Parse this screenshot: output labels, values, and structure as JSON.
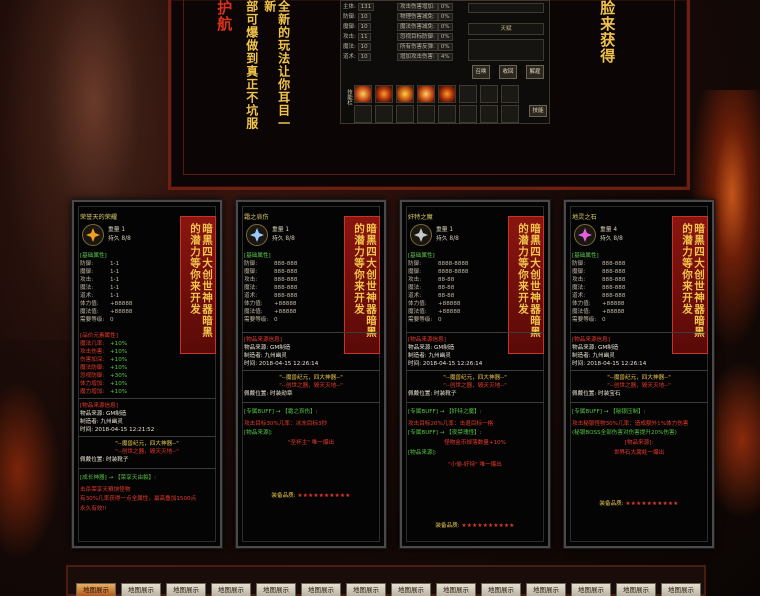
{
  "banner": {
    "col_a": "护航",
    "col_b": "部可爆做到真正不坑服",
    "col_c": "全新的玩法让你耳目一新",
    "col_d": "脸来获得"
  },
  "game_window": {
    "stats_left": [
      {
        "label": "主体:",
        "value": "131"
      },
      {
        "label": "防御:",
        "value": "10"
      },
      {
        "label": "魔御:",
        "value": "10"
      },
      {
        "label": "攻击:",
        "value": "11"
      },
      {
        "label": "魔法:",
        "value": "10"
      },
      {
        "label": "道术:",
        "value": "10"
      }
    ],
    "stats_right": [
      {
        "label": "攻击伤害增加:",
        "value": "0%"
      },
      {
        "label": "物理伤害减免:",
        "value": "0%"
      },
      {
        "label": "魔法伤害减免:",
        "value": "0%"
      },
      {
        "label": "忽视目标防御:",
        "value": "0%"
      },
      {
        "label": "所有伤害反弹:",
        "value": "0%"
      },
      {
        "label": "增加攻击伤害:",
        "value": "4%"
      }
    ],
    "field_label": "天赋",
    "buttons": [
      "召唤",
      "收回",
      "解雇"
    ],
    "skill_label": "技能栏",
    "skill_button": "技能"
  },
  "cards": [
    {
      "title": "荣誉天的荣耀",
      "meta": [
        "重量 1",
        "持久 8/8"
      ],
      "tag": "暗黑四大创世神器暗黑的潜力等你来开发",
      "base_head": "[基础属性]",
      "base": [
        [
          "防御:",
          "1-1"
        ],
        [
          "魔御:",
          "1-1"
        ],
        [
          "攻击:",
          "1-1"
        ],
        [
          "魔法:",
          "1-1"
        ],
        [
          "道术:",
          "1-1"
        ],
        [
          "体力值:",
          "+88888"
        ],
        [
          "魔法值:",
          "+88888"
        ],
        [
          "需要等级:",
          "0"
        ]
      ],
      "extra_head": "[品价元素属性]",
      "extra": [
        [
          "魔法几率:",
          "+10%"
        ],
        [
          "攻击伤害:",
          "+10%"
        ],
        [
          "伤害加深:",
          "+10%"
        ],
        [
          "魔法防御:",
          "+10%"
        ],
        [
          "忽视防御:",
          "+30%"
        ],
        [
          "体力增加:",
          "+10%"
        ],
        [
          "魔力增加:",
          "+10%"
        ]
      ],
      "src_head": "[物品来源信息]",
      "src": [
        "物品来源:   GM制造",
        "制造者:      九州幽灵",
        "时间:         2018-04-15 12:21:52"
      ],
      "legend1": "\"--魔兽纪元，四大神器--\"",
      "legend2": "\"--创世之器，毁天灭地--\"",
      "pos": "佩戴位置:       时装靴子",
      "link_head": "[成长神器] → 【荣享天由裂】:",
      "desc": "击杀荣享天粮饷怪物",
      "desc2": "有30%几率获得一点全属性，最高叠加1500点",
      "desc3": "永久有效!!",
      "stars_label": "",
      "stars": ""
    },
    {
      "title": "霜之哀伤",
      "meta": [
        "重量 1",
        "持久 8/8"
      ],
      "tag": "暗黑四大创世神器暗黑的潜力等你来开发",
      "base_head": "[基础属性]",
      "base": [
        [
          "防御:",
          "888-888"
        ],
        [
          "魔御:",
          "888-888"
        ],
        [
          "攻击:",
          "888-888"
        ],
        [
          "魔法:",
          "888-888"
        ],
        [
          "道术:",
          "888-888"
        ],
        [
          "体力值:",
          "+88888"
        ],
        [
          "魔法值:",
          "+88888"
        ],
        [
          "需要等级:",
          "0"
        ]
      ],
      "extra_head": "",
      "extra": [],
      "src_head": "[物品来源信息]",
      "src": [
        "物品来源:   GM制造",
        "制造者:      九州幽灵",
        "时间:         2018-04-15 12:26:14"
      ],
      "legend1": "\"--魔兽纪元，四大神器--\"",
      "legend2": "\"--创世之器，毁天灭地--\"",
      "pos": "佩戴位置:       时装勋章",
      "link_head": "[专属BUFF] → 【霜之哀伤】:",
      "desc": "攻击目标30%几率：冰冻目标3秒",
      "desc2": "[物品来源]:",
      "desc3": "\"圣杯主\" 唯一爆出",
      "stars_label": "装备品质:",
      "stars": "★★★★★★★★★★"
    },
    {
      "title": "奸特之魔",
      "meta": [
        "重量 1",
        "持久 8/8"
      ],
      "tag": "暗黑四大创世神器暗黑的潜力等你来开发",
      "base_head": "[基础属性]",
      "base": [
        [
          "防御:",
          "8888-8888"
        ],
        [
          "魔御:",
          "8888-8888"
        ],
        [
          "攻击:",
          "88-88"
        ],
        [
          "魔法:",
          "88-88"
        ],
        [
          "道术:",
          "88-88"
        ],
        [
          "体力值:",
          "+88888"
        ],
        [
          "魔法值:",
          "+88888"
        ],
        [
          "需要等级:",
          "0"
        ]
      ],
      "extra_head": "",
      "extra": [],
      "src_head": "[物品来源信息]",
      "src": [
        "物品来源:   GM制造",
        "制造者:      九州幽灵",
        "时间:         2018-04-15 12:26:14"
      ],
      "legend1": "\"--魔兽纪元，四大神器--\"",
      "legend2": "\"--创世之器，毁天灭地--\"",
      "pos": "佩戴位置:       时装靴子",
      "link_head": "[专属BUFF] → 【奸特之魔】:",
      "desc": "攻击目标20%几率：击退目标一格",
      "desc2": "[专属BUFF] → 【夜禁瑰怪】:",
      "desc3": "怪物金币掉落数量+10%",
      "desc4": "[物品来源]:",
      "desc5": "\"小偷-奸特\" 唯一爆出",
      "stars_label": "装备品质:",
      "stars": "★★★★★★★★★★"
    },
    {
      "title": "地灵之石",
      "meta": [
        "重量 4",
        "持久 8/8"
      ],
      "tag": "暗黑四大创世神器暗黑的潜力等你来开发",
      "base_head": "[基础属性]",
      "base": [
        [
          "防御:",
          "888-888"
        ],
        [
          "魔御:",
          "888-888"
        ],
        [
          "攻击:",
          "888-888"
        ],
        [
          "魔法:",
          "888-888"
        ],
        [
          "道术:",
          "888-888"
        ],
        [
          "体力值:",
          "+88888"
        ],
        [
          "魔法值:",
          "+88888"
        ],
        [
          "需要等级:",
          "0"
        ]
      ],
      "extra_head": "",
      "extra": [],
      "src_head": "[物品来源信息]",
      "src": [
        "物品来源:   GM制造",
        "制造者:      九州幽灵",
        "时间:         2018-04-15 12:26:14"
      ],
      "legend1": "\"--魔兽纪元，四大神器--\"",
      "legend2": "\"--创世之器，毁天灭地--\"",
      "pos": "佩戴位置:       时装宝石",
      "link_head": "[专属BUFF] → 【秘银压制】:",
      "desc": "攻击秘银怪物30%几率：造成额外1%体力伤害",
      "desc2": "(秘银BOSS全部伤害对伤害提升20%伤害)",
      "desc3": "[物品来源]:",
      "desc4": "世界石大腐蛀一爆出",
      "stars_label": "装备品质:",
      "stars": "★★★★★★★★★★"
    }
  ],
  "tabs": [
    "地图展示",
    "地图展示",
    "地图展示",
    "地图展示",
    "地图展示",
    "地图展示",
    "地图展示",
    "地图展示",
    "地图展示",
    "地图展示",
    "地图展示",
    "地图展示",
    "地图展示",
    "地图展示"
  ]
}
